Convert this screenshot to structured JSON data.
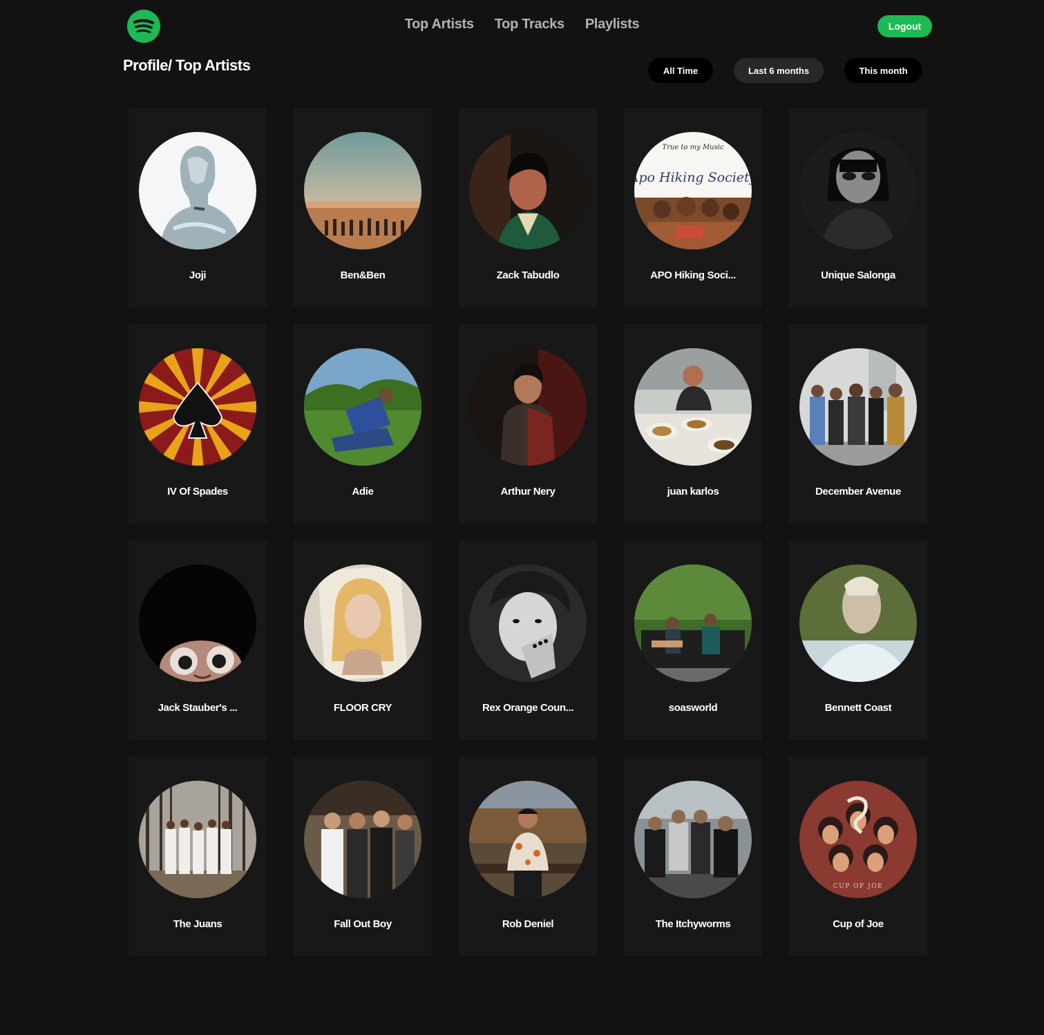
{
  "brand": {
    "accent": "#1db954",
    "logo_icon": "spotify-logo-icon"
  },
  "nav": {
    "items": [
      {
        "label": "Top Artists"
      },
      {
        "label": "Top Tracks"
      },
      {
        "label": "Playlists"
      }
    ],
    "logout_label": "Logout"
  },
  "page": {
    "title": "Profile/ Top Artists"
  },
  "time_range": {
    "options": [
      {
        "label": "All Time"
      },
      {
        "label": "Last 6 months"
      },
      {
        "label": "This month"
      }
    ],
    "selected": "Last 6 months"
  },
  "artists": [
    {
      "name": "Joji"
    },
    {
      "name": "Ben&Ben"
    },
    {
      "name": "Zack Tabudlo"
    },
    {
      "name": "APO Hiking Soci..."
    },
    {
      "name": "Unique Salonga"
    },
    {
      "name": "IV Of Spades"
    },
    {
      "name": "Adie"
    },
    {
      "name": "Arthur Nery"
    },
    {
      "name": "juan karlos"
    },
    {
      "name": "December Avenue"
    },
    {
      "name": "Jack Stauber's ..."
    },
    {
      "name": "FLOOR CRY"
    },
    {
      "name": "Rex Orange Coun..."
    },
    {
      "name": "soasworld"
    },
    {
      "name": "Bennett Coast"
    },
    {
      "name": "The Juans"
    },
    {
      "name": "Fall Out Boy"
    },
    {
      "name": "Rob Deniel"
    },
    {
      "name": "The Itchyworms"
    },
    {
      "name": "Cup of Joe"
    }
  ],
  "artist_images": {
    "apo_logo_text": "True to my Music",
    "apo_script_text": "Apo Hiking Society",
    "cup_of_joe_text": "CUP OF JOE"
  }
}
